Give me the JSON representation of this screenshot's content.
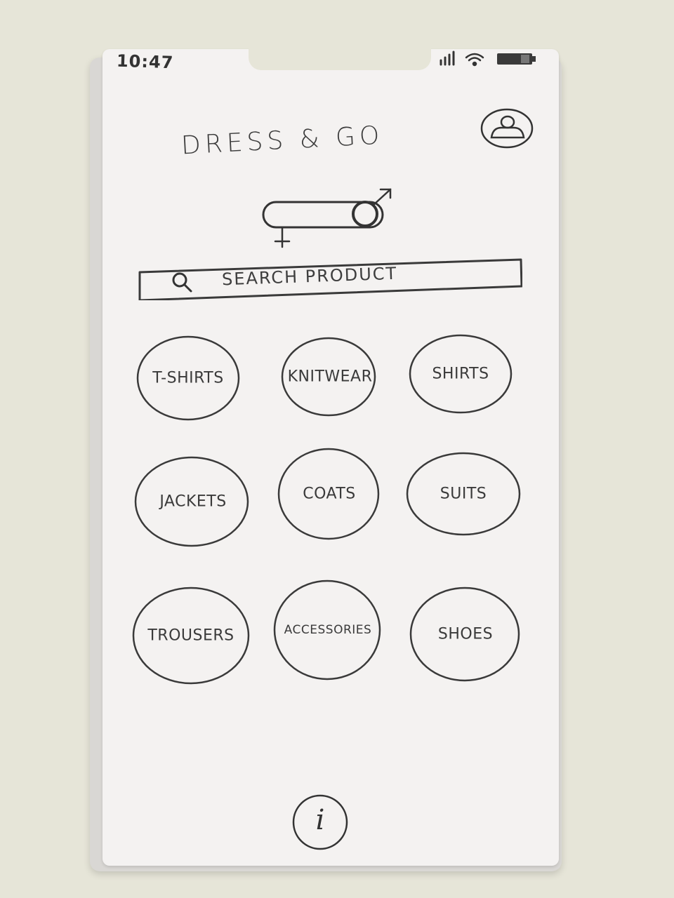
{
  "status_bar": {
    "time": "10:47",
    "signal_icon": "signal-bars-icon",
    "wifi_icon": "wifi-icon",
    "battery_icon": "battery-icon"
  },
  "header": {
    "app_title": "DRESS & GO",
    "profile_icon": "user-profile-icon"
  },
  "gender_toggle": {
    "icon": "gender-toggle-icon",
    "female_symbol": "female-symbol-icon",
    "male_symbol": "male-symbol-icon"
  },
  "search": {
    "placeholder": "SEARCH PRODUCT",
    "icon": "search-icon"
  },
  "categories": [
    {
      "label": "T-SHIRTS"
    },
    {
      "label": "KNITWEAR"
    },
    {
      "label": "SHIRTS"
    },
    {
      "label": "JACKETS"
    },
    {
      "label": "COATS"
    },
    {
      "label": "SUITS"
    },
    {
      "label": "TROUSERS"
    },
    {
      "label": "ACCESSORIES"
    },
    {
      "label": "SHOES"
    }
  ],
  "footer": {
    "info_glyph": "i",
    "info_icon": "info-icon"
  }
}
